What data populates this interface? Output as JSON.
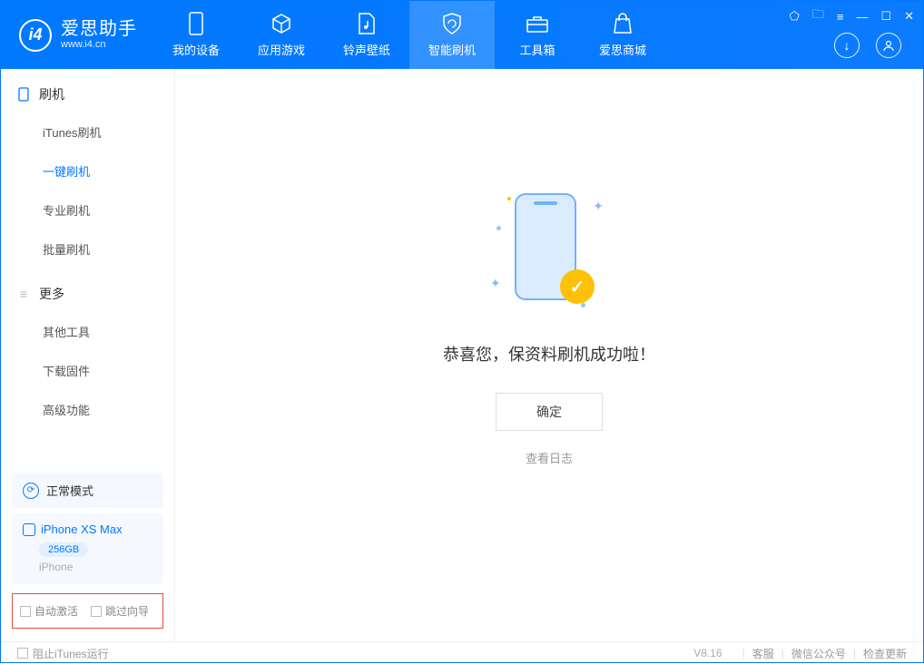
{
  "app": {
    "title": "爱思助手",
    "subtitle": "www.i4.cn"
  },
  "nav": {
    "tabs": [
      {
        "label": "我的设备"
      },
      {
        "label": "应用游戏"
      },
      {
        "label": "铃声壁纸"
      },
      {
        "label": "智能刷机"
      },
      {
        "label": "工具箱"
      },
      {
        "label": "爱思商城"
      }
    ]
  },
  "sidebar": {
    "section1_title": "刷机",
    "items1": [
      {
        "label": "iTunes刷机"
      },
      {
        "label": "一键刷机"
      },
      {
        "label": "专业刷机"
      },
      {
        "label": "批量刷机"
      }
    ],
    "section2_title": "更多",
    "items2": [
      {
        "label": "其他工具"
      },
      {
        "label": "下载固件"
      },
      {
        "label": "高级功能"
      }
    ],
    "mode_label": "正常模式",
    "device": {
      "name": "iPhone XS Max",
      "capacity": "256GB",
      "type": "iPhone"
    },
    "checkbox1": "自动激活",
    "checkbox2": "跳过向导"
  },
  "main": {
    "success_text": "恭喜您，保资料刷机成功啦！",
    "ok_button": "确定",
    "log_link": "查看日志"
  },
  "footer": {
    "block_itunes": "阻止iTunes运行",
    "version": "V8.16",
    "links": [
      "客服",
      "微信公众号",
      "检查更新"
    ]
  }
}
